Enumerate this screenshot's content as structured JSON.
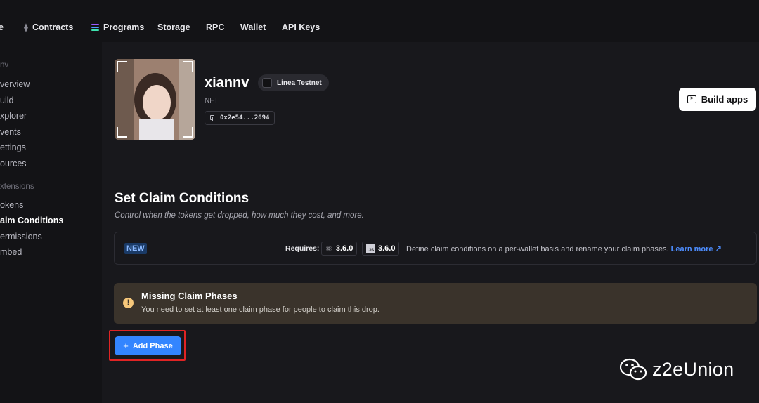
{
  "topnav": {
    "items": [
      {
        "label": "e",
        "icon": ""
      },
      {
        "label": "Contracts",
        "icon": "ethereum-icon"
      },
      {
        "label": "Programs",
        "icon": "solana-icon"
      },
      {
        "label": "Storage",
        "icon": ""
      },
      {
        "label": "RPC",
        "icon": ""
      },
      {
        "label": "Wallet",
        "icon": ""
      },
      {
        "label": "API Keys",
        "icon": ""
      }
    ]
  },
  "sidebar": {
    "project_heading": "nv",
    "items": [
      "verview",
      "uild",
      "xplorer",
      "vents",
      "ettings",
      "ources"
    ],
    "extensions_heading": "xtensions",
    "extension_items": [
      "okens",
      "aim Conditions",
      "ermissions",
      "mbed"
    ],
    "active_item": "aim Conditions"
  },
  "contract": {
    "name": "xiannv",
    "chain": "Linea Testnet",
    "type": "NFT",
    "address": "0x2e54...2694"
  },
  "header": {
    "build_button": "Build apps"
  },
  "claim_conditions": {
    "title": "Set Claim Conditions",
    "subtitle": "Control when the tokens get dropped, how much they cost, and more.",
    "new_badge": "NEW",
    "requires_label": "Requires:",
    "react_version": "3.6.0",
    "js_version": "3.6.0",
    "description": "Define claim conditions on a per-wallet basis and rename your claim phases.",
    "learn_more": "Learn more ↗"
  },
  "alert": {
    "title": "Missing Claim Phases",
    "body": "You need to set at least one claim phase for people to claim this drop."
  },
  "actions": {
    "add_phase": "Add Phase"
  },
  "watermark": {
    "text": "z2eUnion"
  },
  "colors": {
    "accent": "#3385ff",
    "alert_bg": "#3a332b",
    "highlight": "#e02424"
  }
}
